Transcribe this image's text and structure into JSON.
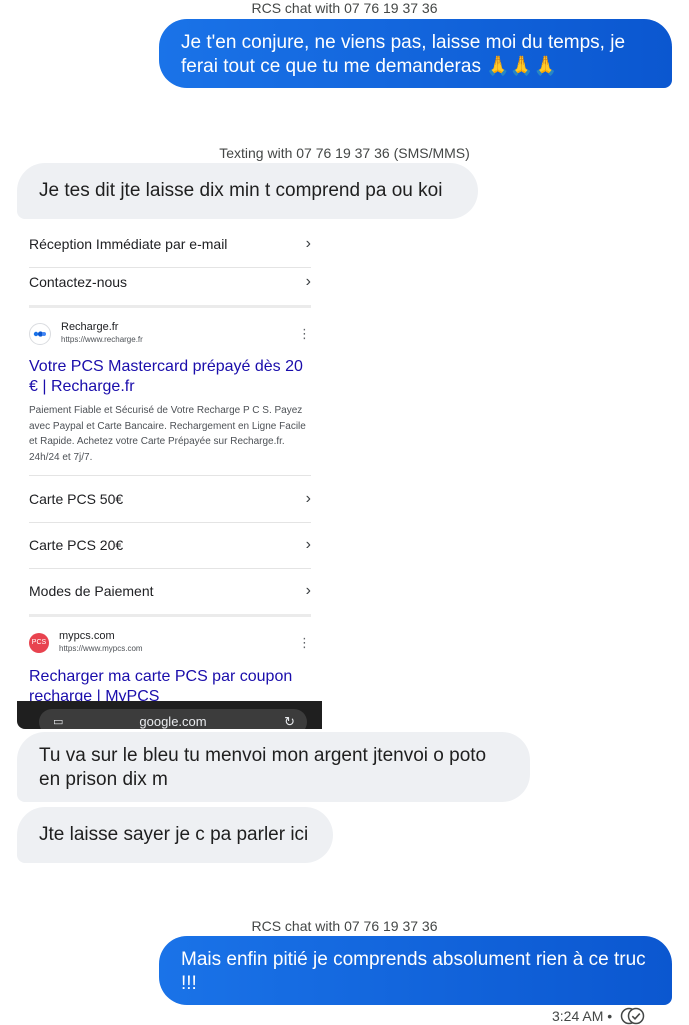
{
  "headers": {
    "top": "RCS chat with 07 76 19 37 36",
    "sms": "Texting with 07 76 19 37 36 (SMS/MMS)",
    "bottom": "RCS chat with 07 76 19 37 36"
  },
  "messages": {
    "out1": "Je t'en conjure, ne viens pas, laisse moi du temps, je ferai tout ce que tu me demanderas 🙏🙏🙏",
    "in1": "Je tes dit jte laisse dix min t comprend pa ou koi",
    "in2": "Tu va sur le bleu tu menvoi mon argent jtenvoi o poto en prison dix m",
    "in3": "Jte laisse sayer je c pa parler ici",
    "out2": "Mais enfin pitié je comprends absolument rien à ce truc !!!"
  },
  "screenshot": {
    "rows_top": [
      "Réception Immédiate par e-mail",
      "Contactez-nous"
    ],
    "result1": {
      "site_name": "Recharge.fr",
      "site_url": "https://www.recharge.fr",
      "title": "Votre PCS Mastercard prépayé dès 20 € | Recharge.fr",
      "snippet": "Paiement Fiable et Sécurisé de Votre Recharge P C S. Payez avec Paypal et Carte Bancaire. Rechargement en Ligne Facile et Rapide. Achetez votre Carte Prépayée sur Recharge.fr. 24h/24 et 7j/7.",
      "favicon_color": "#1a73e8"
    },
    "rows_mid": [
      "Carte PCS 50€",
      "Carte PCS 20€",
      "Modes de Paiement"
    ],
    "result2": {
      "site_name": "mypcs.com",
      "site_url": "https://www.mypcs.com",
      "favicon_text": "PCS",
      "favicon_color": "#e8434f",
      "title": "Recharger ma carte PCS par coupon recharge | MyPCS"
    },
    "urlbar_text": "google.com"
  },
  "status": {
    "time": "3:24 AM •"
  },
  "colors": {
    "outgoing": "#0b57d0",
    "incoming": "#eef0f3",
    "link": "#1a0dab"
  }
}
